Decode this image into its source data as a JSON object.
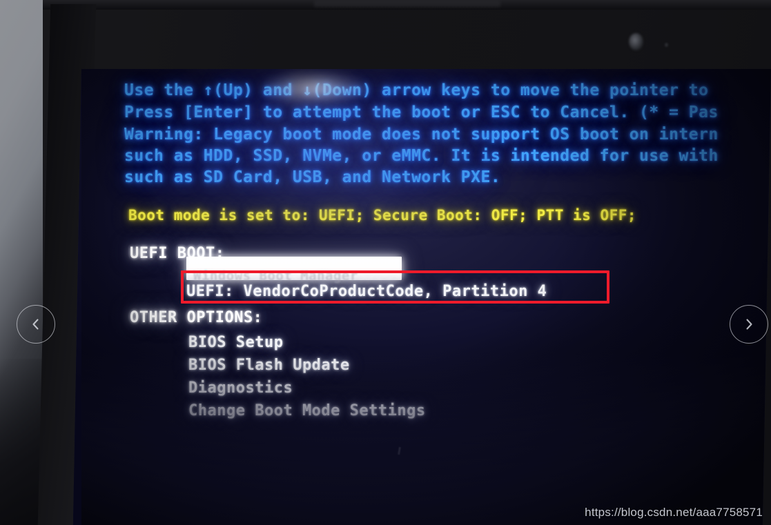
{
  "photo": {
    "subject": "laptop-bios-boot-menu",
    "watermark": "https://blog.csdn.net/aaa7758571"
  },
  "viewer": {
    "prev_label": "‹",
    "next_label": "›",
    "prev_icon": "chevron-left-icon",
    "next_icon": "chevron-right-icon"
  },
  "bios": {
    "instructions": [
      "Use the ↑(Up) and ↓(Down) arrow keys to move the pointer to",
      "Press [Enter] to attempt the boot or ESC to Cancel. (* = Pas",
      "Warning: Legacy boot mode does not support OS boot on intern",
      "such as HDD, SSD, NVMe, or eMMC. It is intended for use with",
      "such as SD Card, USB, and Network PXE."
    ],
    "status_line": "Boot mode is set to: UEFI; Secure Boot: OFF; PTT is OFF;",
    "uefi_boot": {
      "heading": "UEFI BOOT:",
      "selected_entry": "Windows Boot Manager",
      "entries": [
        "UEFI: VendorCoProductCode, Partition 4"
      ]
    },
    "other_options": {
      "heading": "OTHER OPTIONS:",
      "items": [
        "BIOS Setup",
        "BIOS Flash Update",
        "Diagnostics",
        "Change Boot Mode Settings"
      ]
    }
  },
  "colors": {
    "instruction_blue": "#43a8ff",
    "status_yellow": "#f2ec45",
    "menu_white": "#f4f5f8",
    "annotation_red": "#ee1b2b",
    "screen_bg": "#121230"
  }
}
